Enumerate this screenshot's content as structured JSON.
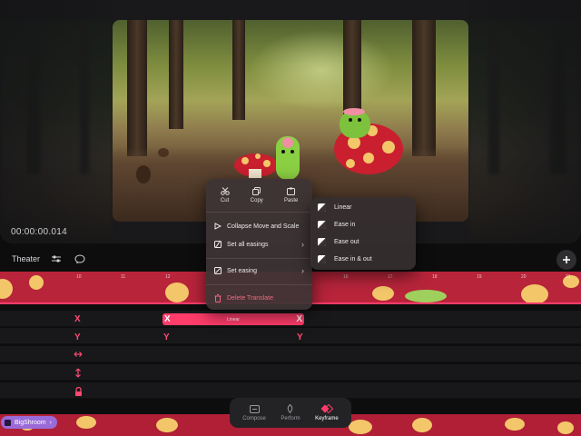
{
  "stage": {
    "timecode": "00:00:00.014"
  },
  "toolbar": {
    "theater_label": "Theater"
  },
  "context_menu": {
    "quick_actions": [
      {
        "label": "Cut",
        "icon": "scissors-icon"
      },
      {
        "label": "Copy",
        "icon": "copy-icon"
      },
      {
        "label": "Paste",
        "icon": "paste-icon"
      }
    ],
    "items": {
      "collapse": "Collapse Move and Scale",
      "set_all_easings": "Set all easings",
      "set_easing": "Set easing",
      "delete": "Delete Translate"
    }
  },
  "easing_menu": {
    "options": [
      "Linear",
      "Ease in",
      "Ease out",
      "Ease in & out"
    ]
  },
  "timeline": {
    "x_label": "X",
    "y_label": "Y",
    "clip_label": "Linear",
    "ruler_numbers": [
      "10",
      "11",
      "12",
      "13",
      "14",
      "15",
      "16",
      "17",
      "18",
      "19",
      "20",
      "21"
    ]
  },
  "asset_chip": {
    "label": "BigShroom"
  },
  "modes": [
    {
      "label": "Compose",
      "icon": "compose-icon"
    },
    {
      "label": "Perform",
      "icon": "perform-icon"
    },
    {
      "label": "Keyframe",
      "icon": "keyframe-icon"
    }
  ],
  "colors": {
    "accent": "#ff3c6a",
    "asset_chip": "#9a6bd8"
  }
}
